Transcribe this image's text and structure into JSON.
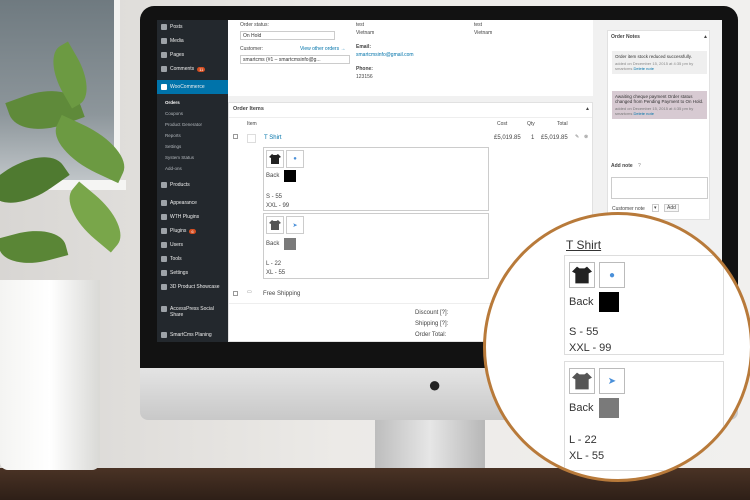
{
  "sidebar": {
    "items": [
      {
        "label": "Posts"
      },
      {
        "label": "Media"
      },
      {
        "label": "Pages"
      },
      {
        "label": "Comments",
        "badge": "11"
      },
      {
        "label": "WooCommerce"
      },
      {
        "label": "Orders"
      },
      {
        "label": "Coupons"
      },
      {
        "label": "Product Generator"
      },
      {
        "label": "Reports"
      },
      {
        "label": "Settings"
      },
      {
        "label": "System Status"
      },
      {
        "label": "Add-ons"
      },
      {
        "label": "Products"
      },
      {
        "label": "Appearance"
      },
      {
        "label": "WTH Plugins"
      },
      {
        "label": "Plugins",
        "badge": "6"
      },
      {
        "label": "Users"
      },
      {
        "label": "Tools"
      },
      {
        "label": "Settings"
      },
      {
        "label": "3D Product Showcase"
      },
      {
        "label": "AccessPress Social Share"
      },
      {
        "label": "SmartCms Planing"
      }
    ]
  },
  "order": {
    "status_label": "Order status:",
    "status_value": "On Hold",
    "customer_label": "Customer:",
    "customer_link": "View other orders →",
    "customer_value": "smartcms (#1 – smartcmsinfo@g...",
    "billing_name": "test",
    "billing_country": "Vietnam",
    "email_label": "Email:",
    "email_value": "smartcmsinfo@gmail.com",
    "phone_label": "Phone:",
    "phone_value": "123156",
    "shipping_name": "test",
    "shipping_country": "Vietnam"
  },
  "items_panel": {
    "title": "Order Items",
    "col_item": "Item",
    "col_cost": "Cost",
    "col_qty": "Qty",
    "col_total": "Total",
    "product_name": "T Shirt",
    "cost": "£5,019.85",
    "qty": "1",
    "total": "£5,019.85",
    "variant1": {
      "side": "Back",
      "line1": "S - 55",
      "line2": "XXL - 99"
    },
    "variant2": {
      "side": "Back",
      "line1": "L - 22",
      "line2": "XL - 55"
    },
    "shipping_name": "Free Shipping",
    "discount_label": "Discount [?]:",
    "shipping_label": "Shipping [?]:",
    "order_total_label": "Order Total:"
  },
  "notes_panel": {
    "title": "Order Notes",
    "note1": "Order item stock reduced successfully.",
    "note1_meta": "added on December 15, 2015 at 4:35 pm by",
    "note1_author": "smartcms",
    "note1_delete": "Delete note",
    "note2": "Awaiting cheque payment Order status changed from Pending Payment to On Hold.",
    "note2_meta": "added on December 15, 2015 at 4:35 pm by",
    "note2_author": "smartcms",
    "note2_delete": "Delete note",
    "add_note_label": "Add note",
    "note_type": "Customer note",
    "add_button": "Add"
  },
  "colors": {
    "sidebar_bg": "#23282d",
    "active_menu": "#0073aa",
    "link": "#0073aa",
    "swatch_black": "#000000",
    "swatch_gray": "#7a7a7a",
    "magnifier_ring": "#b87a3a"
  }
}
